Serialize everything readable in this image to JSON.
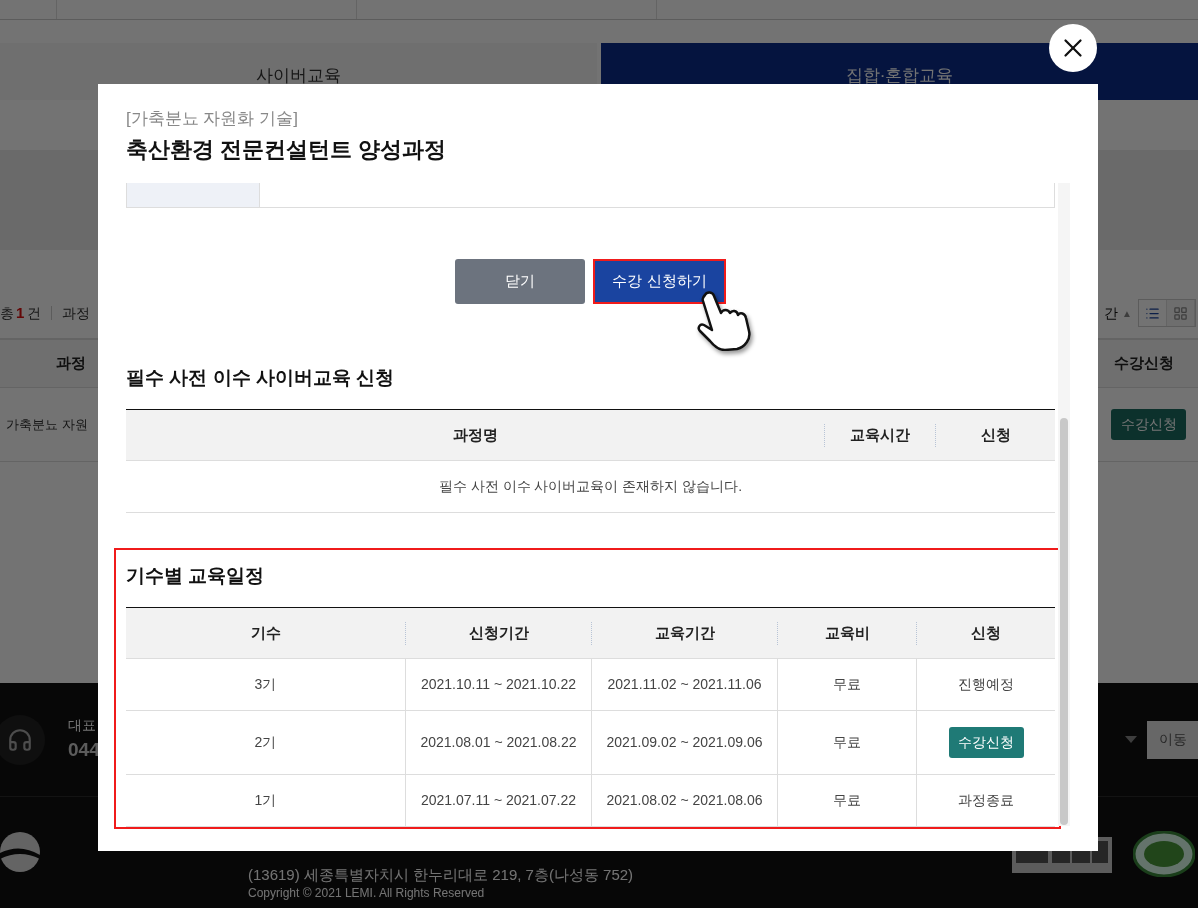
{
  "background_page": {
    "tabs": [
      {
        "label": "사이버교육",
        "selected": false
      },
      {
        "label": "집합·혼합교육",
        "selected": true
      }
    ],
    "list_toolbar": {
      "total_prefix": "총",
      "total_count": "1",
      "total_suffix": "건",
      "filter_label": "과정",
      "sort_label": "간",
      "sort_arrow": "▲",
      "view_toggle": [
        {
          "kind": "list",
          "selected": true
        },
        {
          "kind": "grid",
          "selected": false
        }
      ]
    },
    "table": {
      "columns": [
        "과정",
        "수강신청"
      ],
      "rows": [
        {
          "course": "가축분뇨 자원",
          "action": "수강신청"
        }
      ]
    },
    "footer": {
      "phone_label": "대표",
      "phone": "044",
      "move_button": "이동",
      "address": "(13619)  세종특별자치시 한누리대로 219, 7층(나성동 752)",
      "copyright": "Copyright © 2021 LEMI. All Rights Reserved"
    }
  },
  "modal": {
    "category": "[가축분뇨 자원화 기술]",
    "title": "축산환경 전문컨설턴트 양성과정",
    "buttons": [
      {
        "label": "닫기",
        "kind": "secondary",
        "highlighted": false
      },
      {
        "label": "수강 신청하기",
        "kind": "primary",
        "highlighted": true
      }
    ],
    "prerequisite": {
      "heading": "필수 사전 이수 사이버교육 신청",
      "columns": [
        "과정명",
        "교육시간",
        "신청"
      ],
      "empty_message": "필수 사전 이수 사이버교육이 존재하지 않습니다."
    },
    "schedule": {
      "heading": "기수별 교육일정",
      "highlighted": true,
      "columns": [
        "기수",
        "신청기간",
        "교육기간",
        "교육비",
        "신청"
      ],
      "rows": [
        {
          "cohort": "3기",
          "apply_period": "2021.10.11 ~ 2021.10.22",
          "edu_period": "2021.11.02 ~ 2021.11.06",
          "fee": "무료",
          "status": {
            "kind": "text",
            "label": "진행예정"
          }
        },
        {
          "cohort": "2기",
          "apply_period": "2021.08.01 ~ 2021.08.22",
          "edu_period": "2021.09.02 ~ 2021.09.06",
          "fee": "무료",
          "status": {
            "kind": "button",
            "label": "수강신청"
          }
        },
        {
          "cohort": "1기",
          "apply_period": "2021.07.11 ~ 2021.07.22",
          "edu_period": "2021.08.02 ~ 2021.08.06",
          "fee": "무료",
          "status": {
            "kind": "text",
            "label": "과정종료"
          }
        }
      ]
    }
  }
}
